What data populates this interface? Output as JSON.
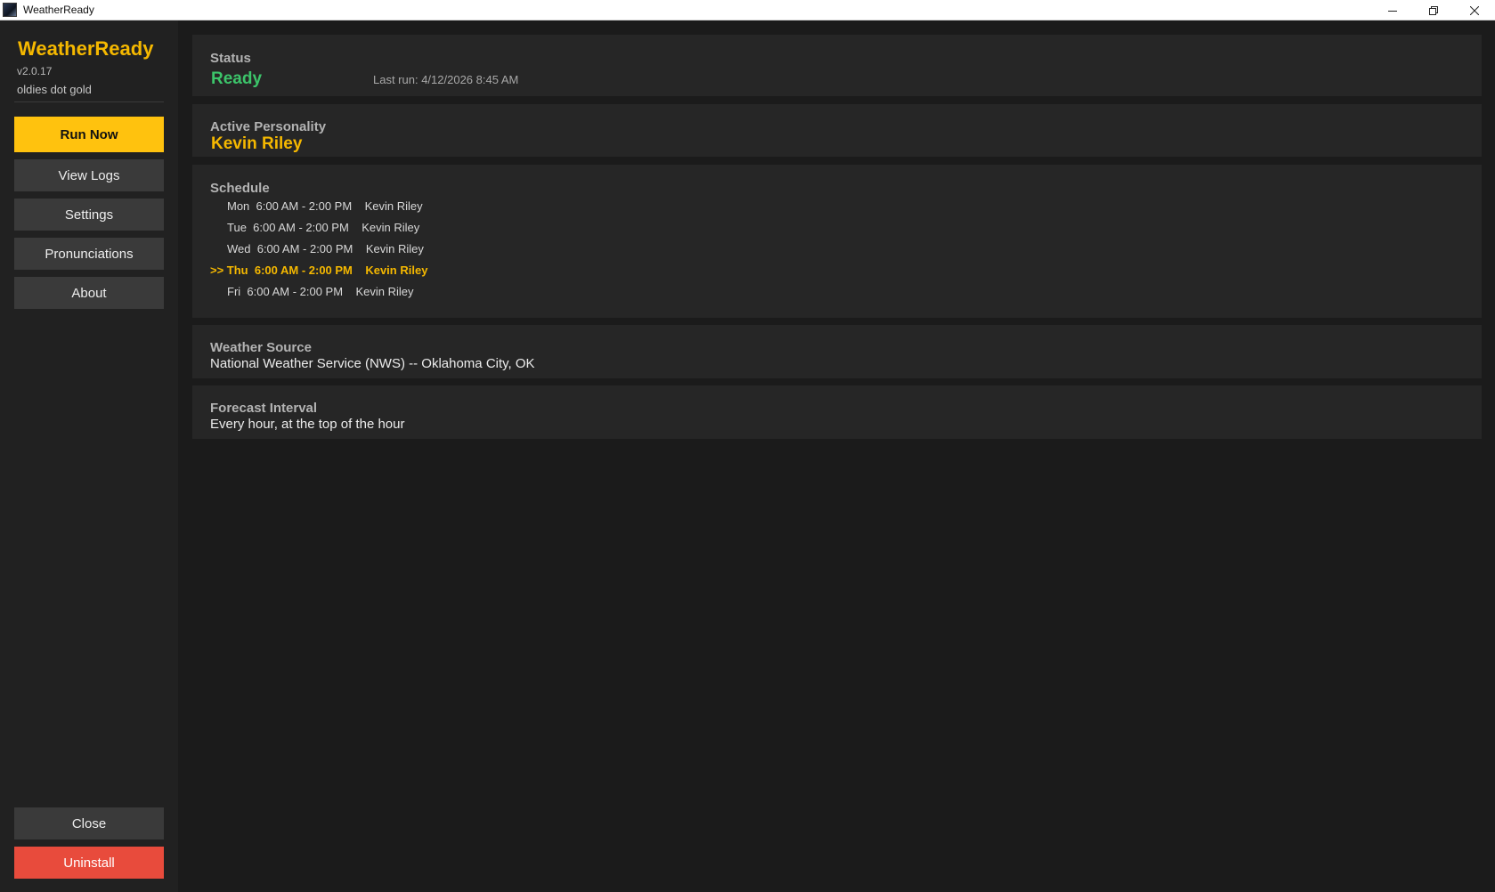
{
  "window": {
    "title": "WeatherReady",
    "controls": [
      "minimize-icon",
      "restore-icon",
      "close-icon"
    ]
  },
  "sidebar": {
    "brand": "WeatherReady",
    "version": "v2.0.17",
    "station": "oldies dot gold",
    "buttons": {
      "run_now": "Run Now",
      "view_logs": "View Logs",
      "settings": "Settings",
      "pronunciations": "Pronunciations",
      "about": "About",
      "close": "Close",
      "uninstall": "Uninstall"
    }
  },
  "status": {
    "label": "Status",
    "value": "Ready",
    "last_run": "Last run: 4/12/2026 8:45 AM"
  },
  "personality": {
    "label": "Active Personality",
    "name": "Kevin Riley"
  },
  "schedule": {
    "label": "Schedule",
    "rows": [
      {
        "text": "Mon  6:00 AM - 2:00 PM    Kevin Riley",
        "current": false
      },
      {
        "text": "Tue  6:00 AM - 2:00 PM    Kevin Riley",
        "current": false
      },
      {
        "text": "Wed  6:00 AM - 2:00 PM    Kevin Riley",
        "current": false
      },
      {
        "text": ">> Thu  6:00 AM - 2:00 PM    Kevin Riley",
        "current": true
      },
      {
        "text": "Fri  6:00 AM - 2:00 PM    Kevin Riley",
        "current": false
      }
    ]
  },
  "weather_source": {
    "label": "Weather Source",
    "value": "National Weather Service (NWS) -- Oklahoma City, OK"
  },
  "forecast_interval": {
    "label": "Forecast Interval",
    "value": "Every hour, at the top of the hour"
  },
  "colors": {
    "accent": "#ffc20e",
    "ready": "#3cc46a",
    "danger": "#e84b3c",
    "background": "#1b1b1b",
    "sidebar": "#212121",
    "card": "#262626"
  }
}
